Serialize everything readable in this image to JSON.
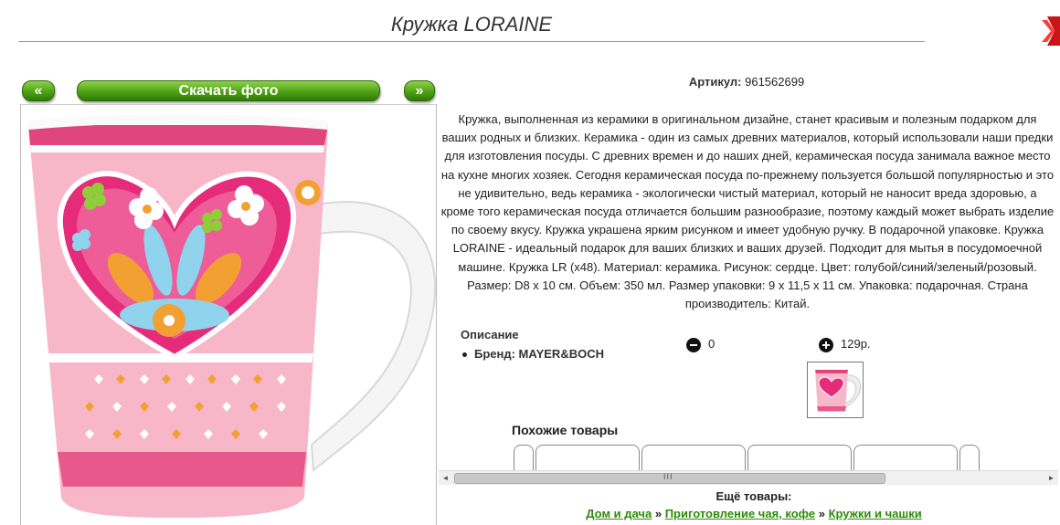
{
  "product": {
    "title": "Кружка LORAINE",
    "article_label": "Артикул:",
    "article_value": "961562699",
    "description": "Кружка, выполненная из керамики в оригинальном дизайне, станет красивым и полезным подарком для ваших родных и близких. Керамика - один из самых древних материалов, который использовали наши предки для изготовления посуды. С древних времен и до наших дней, керамическая посуда занимала важное место на кухне многих хозяек. Сегодня керамическая посуда по-прежнему пользуется большой популярностью и это не удивительно, ведь керамика - экологически чистый материал, который не наносит вреда здоровью, а кроме того керамическая посуда отличается большим разнообразие, поэтому каждый может выбрать изделие по своему вкусу. Кружка украшена ярким рисунком и имеет удобную ручку. В подарочной упаковке. Кружка LORAINE - идеальный подарок для ваших близких и ваших друзей. Подходит для мытья в посудомоечной машине. Кружка LR (х48). Материал: керамика. Рисунок: сердце. Цвет: голубой/синий/зеленый/розовый. Размер: D8 х 10 см. Объем: 350 мл. Размер упаковки: 9 х 11,5 х 11 см. Упаковка: подарочная. Страна производитель: Китай.",
    "info_title": "Описание",
    "brand_line": "Бренд: MAYER&BOCH",
    "quantity": "0",
    "price": "129р."
  },
  "gallery": {
    "prev_label": "«",
    "download_label": "Скачать фото",
    "next_label": "»"
  },
  "similar": {
    "title": "Похожие товары"
  },
  "more": {
    "title": "Ещё товары:",
    "crumbs": [
      {
        "label": "Дом и дача"
      },
      {
        "label": "Приготовление чая, кофе"
      },
      {
        "label": "Кружки и чашки"
      }
    ],
    "separator": "»"
  },
  "scrollbar": {
    "left_arrow": "◄",
    "right_arrow": "►",
    "grip": "III"
  },
  "colors": {
    "accent_green": "#4a9e12",
    "close_red": "#d81b1b",
    "mug_pink": "#f4a9c0"
  },
  "icons": [
    "close-icon",
    "minus-icon",
    "plus-icon"
  ]
}
